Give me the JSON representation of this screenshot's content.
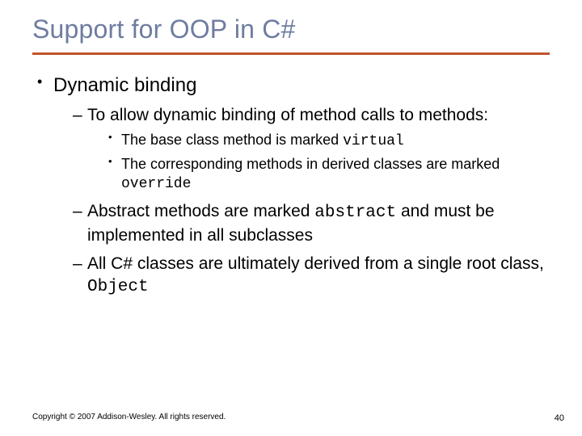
{
  "title": "Support for OOP in C#",
  "bullets": {
    "l1": "Dynamic binding",
    "l2a_pre": "To allow dynamic binding of method calls to methods:",
    "l3a_pre": "The base class method is marked ",
    "l3a_code": "virtual",
    "l3b_pre": "The corresponding methods in derived classes are marked ",
    "l3b_code": "override",
    "l2b_pre": "Abstract methods are marked ",
    "l2b_code": "abstract",
    "l2b_post": " and must be implemented in all subclasses",
    "l2c_pre": "All C# classes are ultimately derived from a single root class, ",
    "l2c_code": "Object"
  },
  "footer": "Copyright © 2007 Addison-Wesley. All rights reserved.",
  "page": "40"
}
